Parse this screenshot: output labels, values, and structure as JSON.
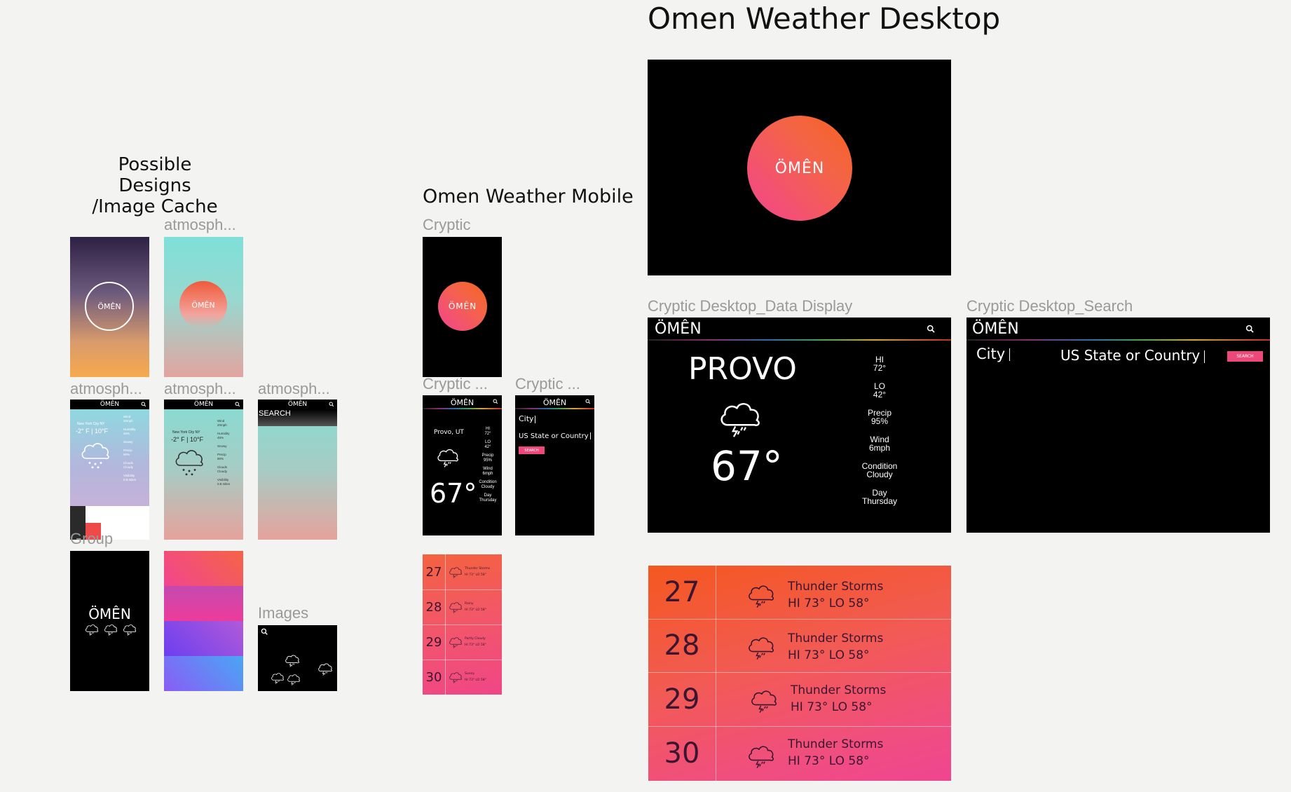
{
  "headers": {
    "possible": "Possible Designs\n/Image Cache",
    "mobile": "Omen Weather Mobile",
    "desktop": "Omen Weather Desktop"
  },
  "labels": {
    "atmos1": "atmosph...",
    "atmos2": "atmosph...",
    "atmos3": "atmosph...",
    "atmos4": "atmosph...",
    "group": "Group",
    "images": "Images",
    "cryptic": "Cryptic",
    "cryptic2": "Cryptic ...",
    "cryptic3": "Cryptic ...",
    "desk_data": "Cryptic Desktop_Data Display",
    "desk_search": "Cryptic Desktop_Search"
  },
  "brand": "ÖMÊN",
  "brand_plain": "ÖMÊN",
  "cache": {
    "nyc": "New York City NY",
    "temp": "-2° F | 10°F",
    "nyc_stats": [
      "Wind\n20mph",
      "Humidity\n45%",
      "Snowy",
      "Precip\n90%",
      "Clouds\nCloudy",
      "Visibility\n0.8 miles"
    ],
    "search": "SEARCH"
  },
  "mobile": {
    "city": "Provo, UT",
    "temp": "67°",
    "stats": [
      "HI\n72°",
      "LO\n42°",
      "Precip\n95%",
      "Wind\n6mph",
      "Condition\nCloudy",
      "Day\nThursday"
    ],
    "city_field": "City",
    "state_field": "US State or Country",
    "search_btn": "SEARCH",
    "forecast": [
      {
        "day": "27",
        "cond": "Thunder Storms",
        "hilo": "HI 73° LO 58°"
      },
      {
        "day": "28",
        "cond": "Rainy",
        "hilo": "HI 73° LO 58°"
      },
      {
        "day": "29",
        "cond": "Partly Cloudy",
        "hilo": "HI 73° LO 58°"
      },
      {
        "day": "30",
        "cond": "Sunny",
        "hilo": "HI 73° LO 58°"
      }
    ]
  },
  "desktop": {
    "city": "PROVO",
    "temp": "67°",
    "stats": [
      "HI\n72°",
      "LO\n42°",
      "Precip\n95%",
      "Wind\n6mph",
      "Condition\nCloudy",
      "Day\nThursday"
    ],
    "city_field": "City",
    "state_field": "US State or Country",
    "search_btn": "SEARCH",
    "forecast": [
      {
        "day": "27",
        "cond": "Thunder Storms",
        "hilo": "HI 73°  LO 58°"
      },
      {
        "day": "28",
        "cond": "Thunder Storms",
        "hilo": "HI 73°  LO 58°"
      },
      {
        "day": "29",
        "cond": "Thunder Storms",
        "hilo": "HI 73°  LO 58°"
      },
      {
        "day": "30",
        "cond": "Thunder Storms",
        "hilo": "HI 73°  LO 58°"
      }
    ]
  },
  "colors": {
    "accent_pink": "#f0477b",
    "accent_orange": "#f4581f",
    "background": "#f3f3f1"
  }
}
